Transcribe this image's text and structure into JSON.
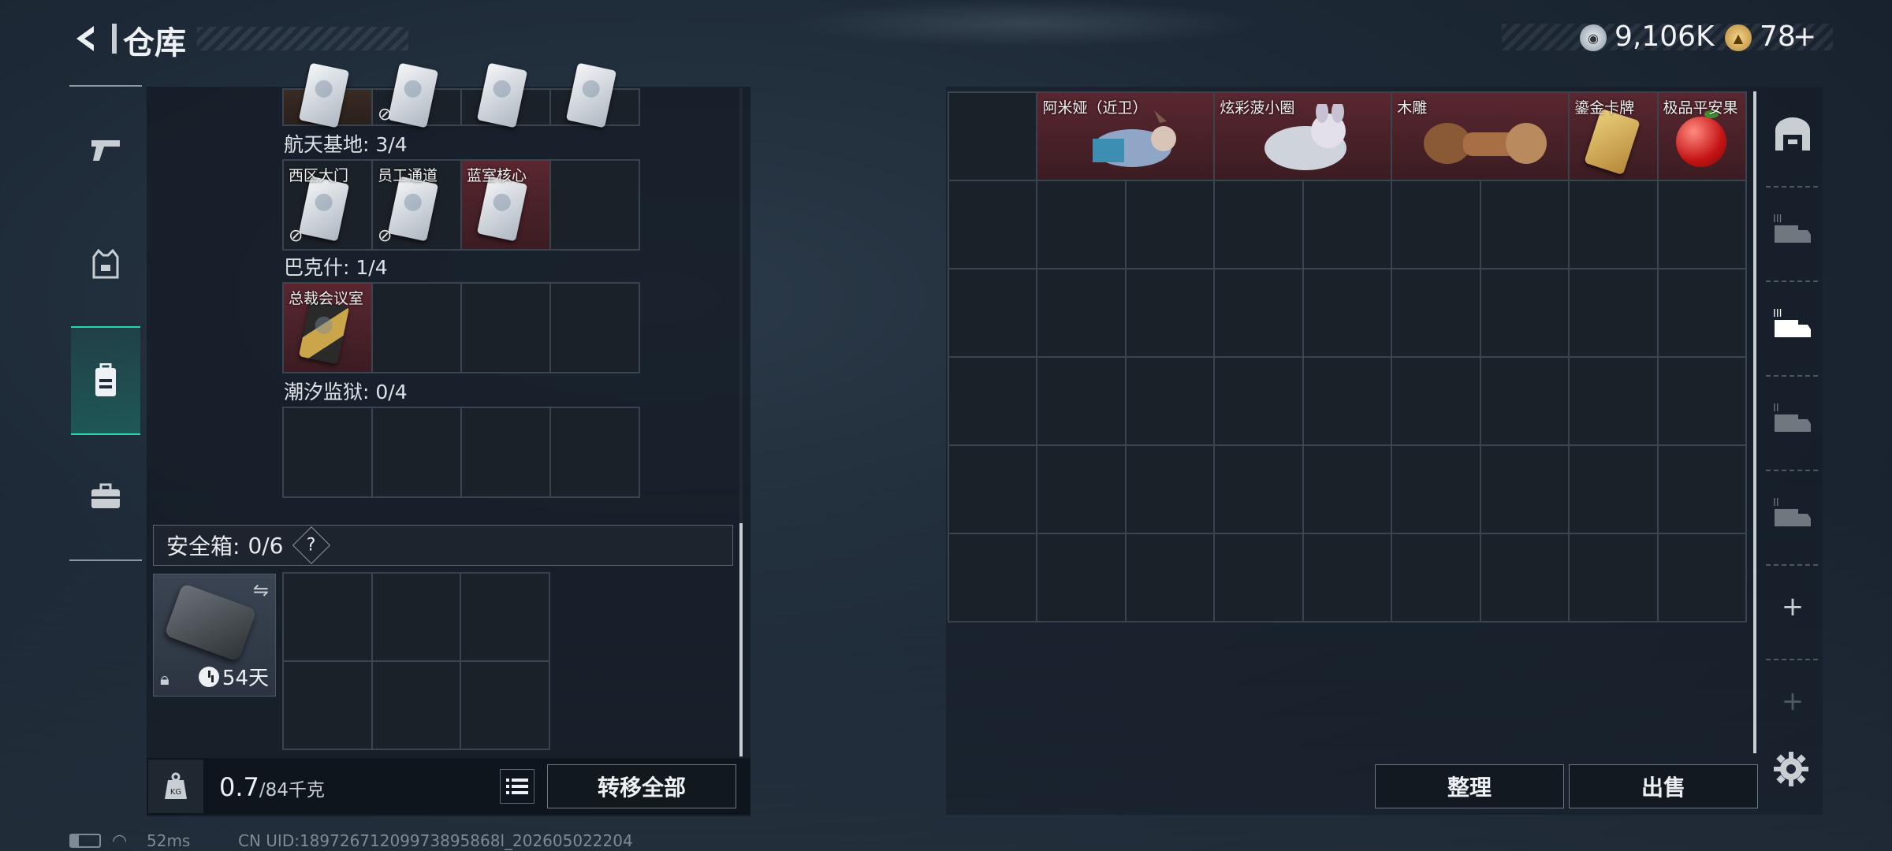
{
  "header": {
    "title": "仓库",
    "currency_silver": "9,106K",
    "currency_gold": "78",
    "plus": "+"
  },
  "nav": {
    "items": [
      "weapons",
      "armor",
      "backpack",
      "toolbox"
    ],
    "active": "backpack"
  },
  "left": {
    "top_partial_row": [
      "",
      "",
      "",
      ""
    ],
    "sections": [
      {
        "label": "航天基地: 3/4",
        "cells": [
          "西区大门",
          "员工通道",
          "蓝室核心",
          ""
        ]
      },
      {
        "label": "巴克什: 1/4",
        "cells": [
          "总裁会议室",
          "",
          "",
          ""
        ]
      },
      {
        "label": "潮汐监狱: 0/4",
        "cells": [
          "",
          "",
          "",
          ""
        ]
      }
    ],
    "safe": {
      "title": "安全箱:",
      "count": "0/6",
      "help": "?",
      "days": "54天"
    },
    "weight": {
      "value": "0.7",
      "max": "/84千克"
    },
    "transfer_all": "转移全部"
  },
  "right": {
    "items": [
      {
        "name": "阿米娅（近卫）",
        "cols": 2
      },
      {
        "name": "炫彩菠小圈",
        "cols": 2
      },
      {
        "name": "木雕",
        "cols": 2
      },
      {
        "name": "鎏金卡牌",
        "cols": 1
      },
      {
        "name": "极品平安果",
        "cols": 1
      }
    ],
    "tabs": [
      "III",
      "III",
      "II",
      "II"
    ],
    "plus": "+",
    "sort_label": "整理",
    "sell_label": "出售"
  },
  "status": {
    "ping": "52ms",
    "uid": "CN UID:18972671209973895868l_202605022204"
  },
  "colors": {
    "accent": "#28d6a8",
    "red_cell": "#5a2730"
  }
}
